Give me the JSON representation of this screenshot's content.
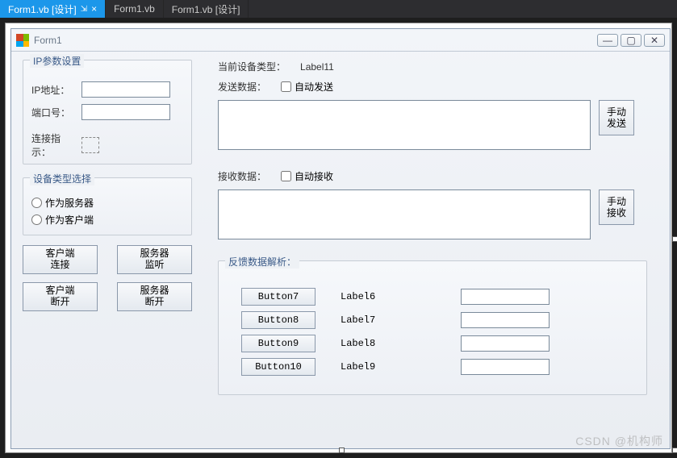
{
  "tabs": [
    {
      "label": "Form1.vb [设计]",
      "active": true,
      "closable": true
    },
    {
      "label": "Form1.vb",
      "active": false
    },
    {
      "label": "Form1.vb [设计]",
      "active": false
    }
  ],
  "window": {
    "title": "Form1",
    "buttons": {
      "min": "—",
      "max": "▢",
      "close": "✕"
    }
  },
  "ip_group": {
    "legend": "IP参数设置",
    "ip_label": "IP地址：",
    "ip_value": "",
    "port_label": "端口号：",
    "port_value": "",
    "conn_label": "连接指示："
  },
  "dev_group": {
    "legend": "设备类型选择",
    "opt_server": "作为服务器",
    "opt_client": "作为客户端"
  },
  "conn_buttons": {
    "client_connect": "客户端\n连接",
    "server_listen": "服务器\n监听",
    "client_disconnect": "客户端\n断开",
    "server_disconnect": "服务器\n断开"
  },
  "right": {
    "curdev_label": "当前设备类型：",
    "curdev_value": "Label11",
    "send_label": "发送数据：",
    "auto_send": "自动发送",
    "send_value": "",
    "manual_send": "手动\n发送",
    "recv_label": "接收数据：",
    "auto_recv": "自动接收",
    "recv_value": "",
    "manual_recv": "手动\n接收"
  },
  "parse_group": {
    "legend": "反馈数据解析：",
    "rows": [
      {
        "btn": "Button7",
        "lbl": "Label6",
        "val": ""
      },
      {
        "btn": "Button8",
        "lbl": "Label7",
        "val": ""
      },
      {
        "btn": "Button9",
        "lbl": "Label8",
        "val": ""
      },
      {
        "btn": "Button10",
        "lbl": "Label9",
        "val": ""
      }
    ]
  },
  "watermark": "CSDN @机构师"
}
